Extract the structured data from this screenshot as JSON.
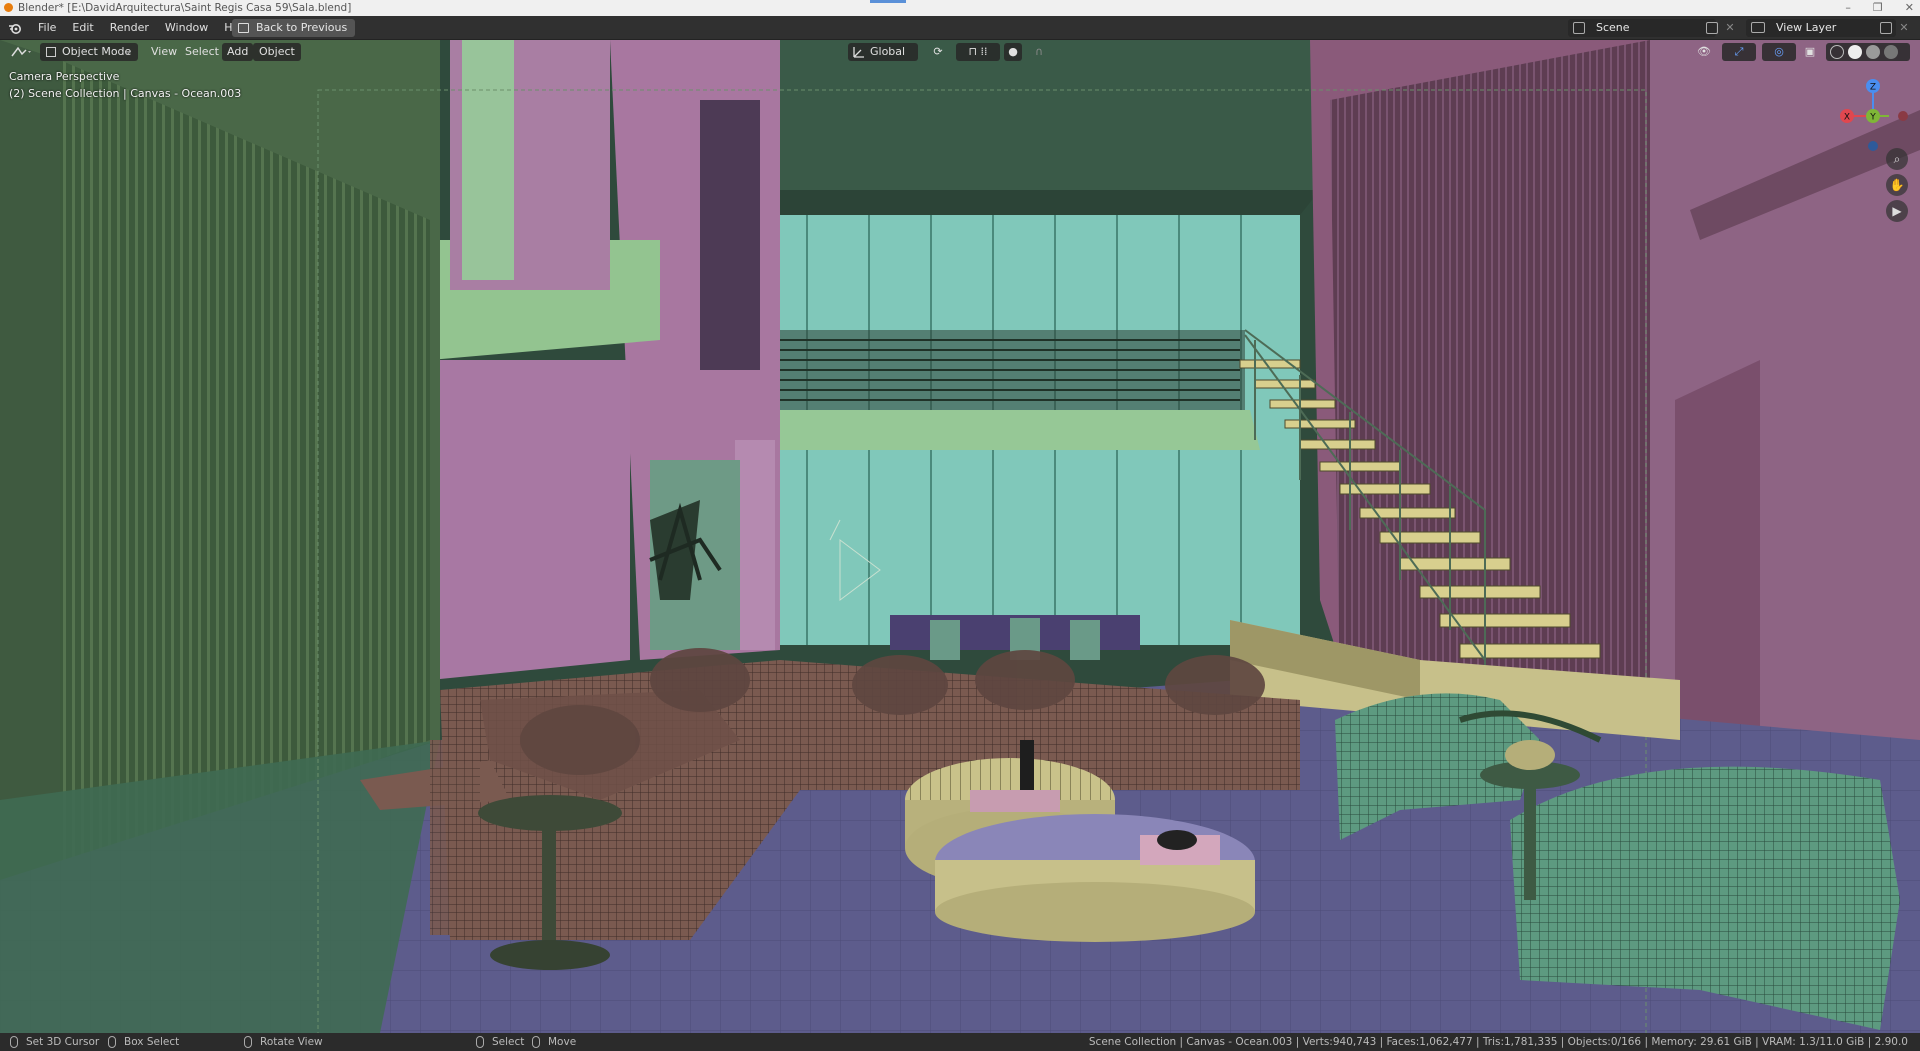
{
  "window": {
    "title": "Blender* [E:\\DavidArquitectura\\Saint Regis Casa 59\\Sala.blend]",
    "controls": [
      "–",
      "❐",
      "✕"
    ]
  },
  "topbar": {
    "menu": [
      "File",
      "Edit",
      "Render",
      "Window",
      "Help"
    ],
    "back_button": "Back to Previous",
    "scene_label": "Scene",
    "view_layer_label": "View Layer"
  },
  "viewport_header": {
    "mode": "Object Mode",
    "menus": [
      "View",
      "Select",
      "Add",
      "Object"
    ],
    "transform_orientation": "Global"
  },
  "viewport_overlay": {
    "camera": "Camera Perspective",
    "collection": "(2) Scene Collection | Canvas - Ocean.003"
  },
  "gizmo": {
    "x": "X",
    "y": "Y",
    "z": "Z"
  },
  "statusbar": {
    "set_cursor": "Set 3D Cursor",
    "box_select": "Box Select",
    "rotate_view": "Rotate View",
    "select": "Select",
    "move": "Move",
    "stats": "Scene Collection | Canvas - Ocean.003 | Verts:940,743 | Faces:1,062,477 | Tris:1,781,335 | Objects:0/166 | Memory: 29.61 GiB | VRAM: 1.3/11.0 GiB | 2.90.0"
  },
  "colors": {
    "ui_bg": "#303030",
    "viewport_wall_green": "#4a6848",
    "viewport_wall_pink": "#a97ea3",
    "viewport_floor": "#5d5c8c",
    "viewport_glass": "#7ec9b9",
    "gizmo_x": "#e0474f",
    "gizmo_y": "#7fb637",
    "gizmo_z": "#4a8ef0"
  }
}
